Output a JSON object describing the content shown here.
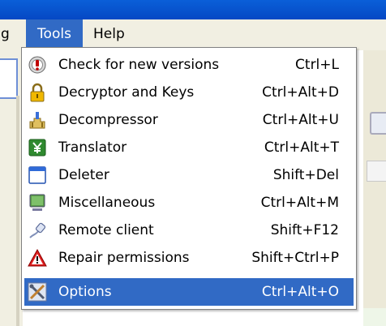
{
  "menubar": {
    "items": [
      {
        "label": "g"
      },
      {
        "label": "Tools"
      },
      {
        "label": "Help"
      }
    ]
  },
  "tools_menu": {
    "items": [
      {
        "label": "Check for new versions",
        "shortcut": "Ctrl+L",
        "icon": "update-check-icon"
      },
      {
        "label": "Decryptor and Keys",
        "shortcut": "Ctrl+Alt+D",
        "icon": "padlock-icon"
      },
      {
        "label": "Decompressor",
        "shortcut": "Ctrl+Alt+U",
        "icon": "decompressor-icon"
      },
      {
        "label": "Translator",
        "shortcut": "Ctrl+Alt+T",
        "icon": "yen-translator-icon"
      },
      {
        "label": "Deleter",
        "shortcut": "Shift+Del",
        "icon": "window-icon"
      },
      {
        "label": "Miscellaneous",
        "shortcut": "Ctrl+Alt+M",
        "icon": "monitor-icon"
      },
      {
        "label": "Remote client",
        "shortcut": "Shift+F12",
        "icon": "network-plug-icon"
      },
      {
        "label": "Repair permissions",
        "shortcut": "Shift+Ctrl+P",
        "icon": "warning-icon"
      }
    ],
    "options": {
      "label": "Options",
      "shortcut": "Ctrl+Alt+O",
      "icon": "tools-icon"
    }
  },
  "colors": {
    "highlight": "#316ac5",
    "titlebar": "#0548c4",
    "menubar": "#f1efe2"
  }
}
